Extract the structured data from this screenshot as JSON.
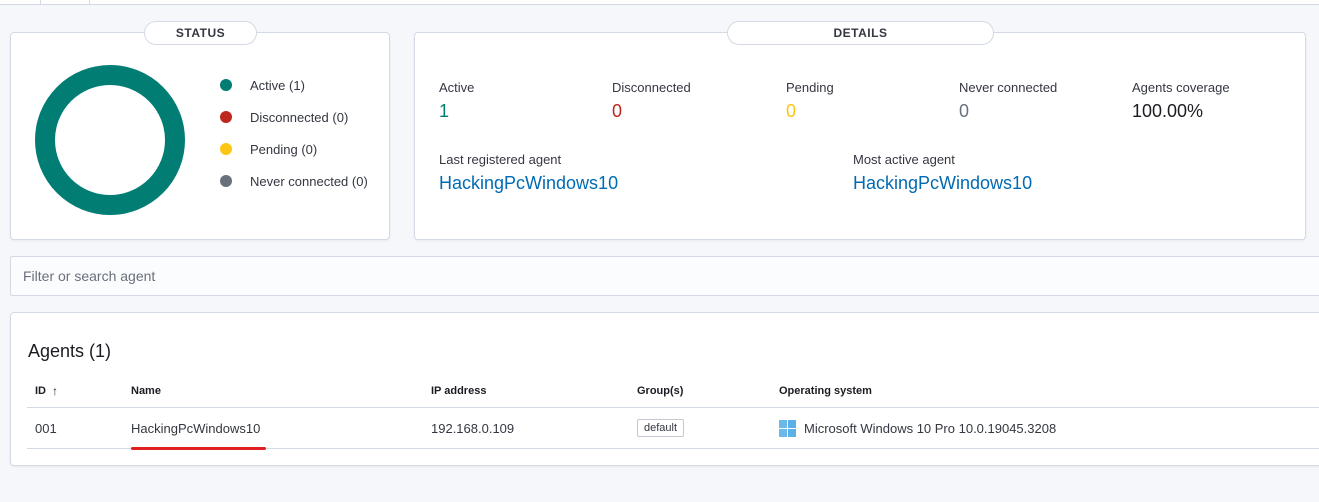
{
  "status": {
    "title": "STATUS",
    "legend": [
      {
        "label": "Active (1)",
        "color": "#017d73"
      },
      {
        "label": "Disconnected (0)",
        "color": "#bd271e"
      },
      {
        "label": "Pending (0)",
        "color": "#fec514"
      },
      {
        "label": "Never connected (0)",
        "color": "#69707d"
      }
    ]
  },
  "details": {
    "title": "DETAILS",
    "stats": [
      {
        "label": "Active",
        "value": "1",
        "color": "#017d73"
      },
      {
        "label": "Disconnected",
        "value": "0",
        "color": "#bd271e"
      },
      {
        "label": "Pending",
        "value": "0",
        "color": "#fec514"
      },
      {
        "label": "Never connected",
        "value": "0",
        "color": "#69707d"
      },
      {
        "label": "Agents coverage",
        "value": "100.00%",
        "color": "#1a1c21"
      }
    ],
    "last_registered": {
      "label": "Last registered agent",
      "value": "HackingPcWindows10"
    },
    "most_active": {
      "label": "Most active agent",
      "value": "HackingPcWindows10"
    }
  },
  "search": {
    "placeholder": "Filter or search agent"
  },
  "agents": {
    "heading": "Agents (1)",
    "columns": {
      "id": "ID",
      "name": "Name",
      "ip": "IP address",
      "groups": "Group(s)",
      "os": "Operating system"
    },
    "sort_icon": "↑",
    "rows": [
      {
        "id": "001",
        "name": "HackingPcWindows10",
        "ip": "192.168.0.109",
        "group": "default",
        "os": "Microsoft Windows 10 Pro 10.0.19045.3208",
        "os_icon": "windows-icon"
      }
    ]
  }
}
